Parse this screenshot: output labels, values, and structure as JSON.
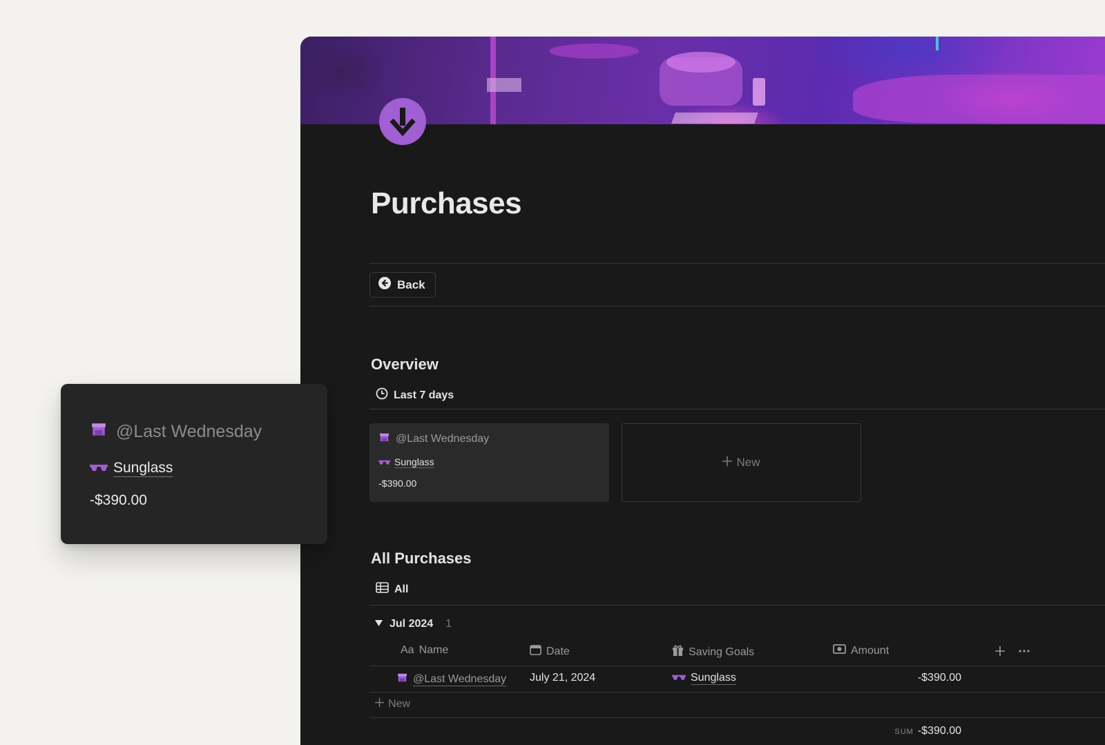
{
  "page": {
    "title": "Purchases",
    "back_label": "Back"
  },
  "overview": {
    "title": "Overview",
    "view_label": "Last 7 days",
    "card": {
      "title": "@Last Wednesday",
      "goal": "Sunglass",
      "amount": "-$390.00"
    },
    "new_label": "New"
  },
  "all_purchases": {
    "title": "All Purchases",
    "view_label": "All",
    "group": {
      "label": "Jul 2024",
      "count": "1"
    },
    "columns": {
      "name_prefix": "Aa",
      "name": "Name",
      "date": "Date",
      "goals": "Saving Goals",
      "amount": "Amount"
    },
    "row": {
      "name": "@Last Wednesday",
      "date": "July 21, 2024",
      "goal": "Sunglass",
      "amount": "-$390.00"
    },
    "new_label": "New",
    "sum_label": "SUM",
    "sum_value": "-$390.00"
  },
  "popup": {
    "title": "@Last Wednesday",
    "goal": "Sunglass",
    "amount": "-$390.00"
  },
  "colors": {
    "accent_purple": "#a05fd2",
    "background": "#191919",
    "outer_background": "#f3f2ee"
  },
  "icons": {
    "page": "arrow-down-circle-icon",
    "back": "arrow-left-circle-icon",
    "overview_view": "clock-icon",
    "all_view": "table-icon",
    "name_item": "store-icon",
    "goal_item": "sunglasses-icon",
    "date_column": "calendar-icon",
    "goals_column": "gift-icon",
    "amount_column": "banknote-icon"
  }
}
